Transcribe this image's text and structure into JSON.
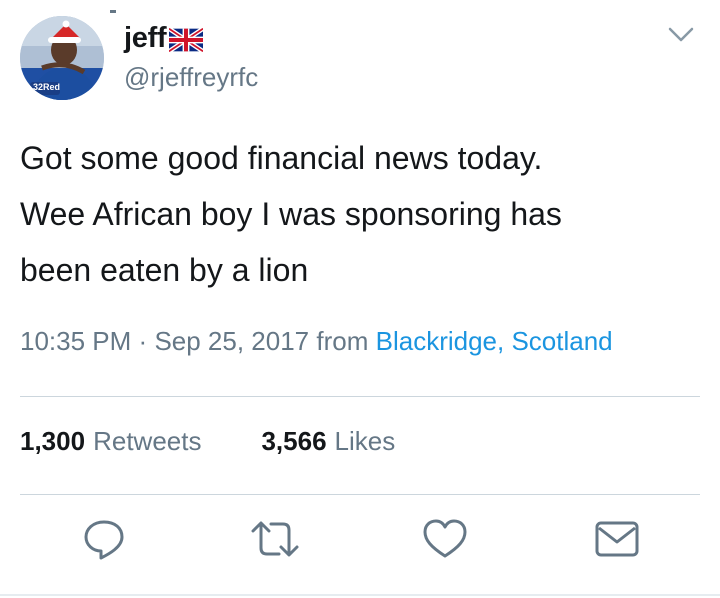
{
  "tweet": {
    "author": {
      "display_name": "jeff",
      "handle": "@rjeffreyrfc",
      "avatar_badge": "32Red",
      "flag_icon": "union-jack-flag-icon"
    },
    "menu_icon": "chevron-down-icon",
    "text_lines": [
      "Got some good financial news today.",
      "Wee African boy I was sponsoring has",
      "been eaten by a lion"
    ],
    "time": "10:35 PM",
    "separator": "·",
    "date": "Sep 25, 2017",
    "from_label": "from",
    "location": "Blackridge, Scotland",
    "retweets": {
      "count": "1,300",
      "label": "Retweets"
    },
    "likes": {
      "count": "3,566",
      "label": "Likes"
    },
    "actions": [
      {
        "name": "reply",
        "icon": "reply-icon"
      },
      {
        "name": "retweet",
        "icon": "retweet-icon"
      },
      {
        "name": "like",
        "icon": "heart-icon"
      },
      {
        "name": "direct-message",
        "icon": "envelope-icon"
      }
    ]
  },
  "colors": {
    "text": "#14171a",
    "secondary": "#657786",
    "link": "#1b95e0",
    "divider": "#ccd6dd",
    "icon": "#657786"
  }
}
